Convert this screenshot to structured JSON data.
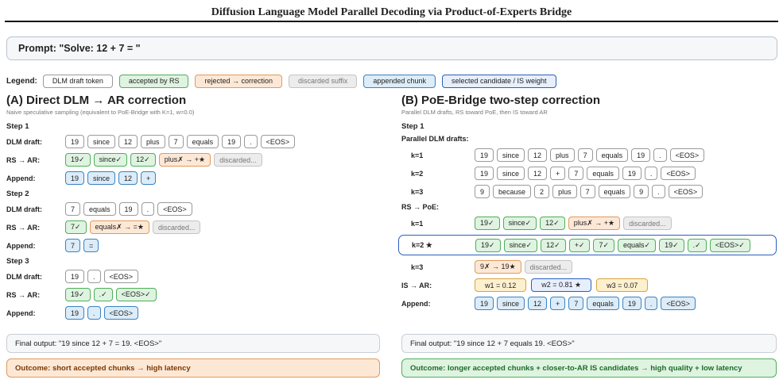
{
  "title": "Diffusion Language Model Parallel Decoding via Product-of-Experts Bridge",
  "prompt": "Prompt: \"Solve: 12 + 7 = \"",
  "legend": {
    "label": "Legend:",
    "items": [
      {
        "label": "DLM draft token",
        "kind": "draft"
      },
      {
        "label": "accepted by RS",
        "kind": "acc"
      },
      {
        "label": "rejected → correction",
        "kind": "rej"
      },
      {
        "label": "discarded suffix",
        "kind": "disc"
      },
      {
        "label": "appended chunk",
        "kind": "app"
      },
      {
        "label": "selected candidate / IS weight",
        "kind": "sel"
      }
    ]
  },
  "panel_a": {
    "title": "(A) Direct DLM → AR correction",
    "subtitle": "Naive speculative sampling (equivalent to PoE-Bridge with K=1, w=0.0)",
    "steps": [
      {
        "label": "Step 1",
        "draft_label": "DLM draft:",
        "draft": [
          "19",
          "since",
          "12",
          "plus",
          "7",
          "equals",
          "19",
          ".",
          "<EOS>"
        ],
        "rs_label": "RS → AR:",
        "rs": [
          {
            "t": "19✓",
            "k": "acc"
          },
          {
            "t": "since✓",
            "k": "acc"
          },
          {
            "t": "12✓",
            "k": "acc"
          },
          {
            "t": "plus✗ → +★",
            "k": "rej"
          },
          {
            "t": "discarded...",
            "k": "disc"
          }
        ],
        "append_label": "Append:",
        "append": [
          "19",
          "since",
          "12",
          "+"
        ]
      },
      {
        "label": "Step 2",
        "draft_label": "DLM draft:",
        "draft": [
          "7",
          "equals",
          "19",
          ".",
          "<EOS>"
        ],
        "rs_label": "RS → AR:",
        "rs": [
          {
            "t": "7✓",
            "k": "acc"
          },
          {
            "t": "equals✗ → =★",
            "k": "rej"
          },
          {
            "t": "discarded...",
            "k": "disc"
          }
        ],
        "append_label": "Append:",
        "append": [
          "7",
          "="
        ]
      },
      {
        "label": "Step 3",
        "draft_label": "DLM draft:",
        "draft": [
          "19",
          ".",
          "<EOS>"
        ],
        "rs_label": "RS → AR:",
        "rs": [
          {
            "t": "19✓",
            "k": "acc"
          },
          {
            "t": ".✓",
            "k": "acc"
          },
          {
            "t": "<EOS>✓",
            "k": "acc"
          }
        ],
        "append_label": "Append:",
        "append": [
          "19",
          ".",
          "<EOS>"
        ]
      }
    ],
    "final_output": "Final output: \"19 since 12 + 7 = 19. <EOS>\"",
    "outcome": "Outcome: short accepted chunks → high latency"
  },
  "panel_b": {
    "title": "(B) PoE-Bridge two-step correction",
    "subtitle": "Parallel DLM drafts, RS toward PoE, then IS toward AR",
    "step_label": "Step 1",
    "drafts_label": "Parallel DLM drafts:",
    "drafts": [
      {
        "k": "k=1",
        "tokens": [
          "19",
          "since",
          "12",
          "plus",
          "7",
          "equals",
          "19",
          ".",
          "<EOS>"
        ]
      },
      {
        "k": "k=2",
        "tokens": [
          "19",
          "since",
          "12",
          "+",
          "7",
          "equals",
          "19",
          ".",
          "<EOS>"
        ]
      },
      {
        "k": "k=3",
        "tokens": [
          "9",
          "because",
          "2",
          "plus",
          "7",
          "equals",
          "9",
          ".",
          "<EOS>"
        ]
      }
    ],
    "rs_label": "RS → PoE:",
    "rs": [
      {
        "k": "k=1",
        "selected": false,
        "tokens": [
          {
            "t": "19✓",
            "k": "acc"
          },
          {
            "t": "since✓",
            "k": "acc"
          },
          {
            "t": "12✓",
            "k": "acc"
          },
          {
            "t": "plus✗ → +★",
            "k": "rej"
          },
          {
            "t": "discarded...",
            "k": "disc"
          }
        ]
      },
      {
        "k": "k=2 ★",
        "selected": true,
        "tokens": [
          {
            "t": "19✓",
            "k": "acc"
          },
          {
            "t": "since✓",
            "k": "acc"
          },
          {
            "t": "12✓",
            "k": "acc"
          },
          {
            "t": "+✓",
            "k": "acc"
          },
          {
            "t": "7✓",
            "k": "acc"
          },
          {
            "t": "equals✓",
            "k": "acc"
          },
          {
            "t": "19✓",
            "k": "acc"
          },
          {
            "t": ".✓",
            "k": "acc"
          },
          {
            "t": "<EOS>✓",
            "k": "acc"
          }
        ]
      },
      {
        "k": "k=3",
        "selected": false,
        "tokens": [
          {
            "t": "9✗ → 19★",
            "k": "rej"
          },
          {
            "t": "discarded...",
            "k": "disc"
          }
        ]
      }
    ],
    "is_label": "IS → AR:",
    "is_weights": [
      {
        "t": "w1 = 0.12",
        "k": "w"
      },
      {
        "t": "w2 = 0.81 ★",
        "k": "wsel"
      },
      {
        "t": "w3 = 0.07",
        "k": "w"
      }
    ],
    "append_label": "Append:",
    "append": [
      "19",
      "since",
      "12",
      "+",
      "7",
      "equals",
      "19",
      ".",
      "<EOS>"
    ],
    "final_output": "Final output: \"19 since 12 + 7 equals 19. <EOS>\"",
    "outcome": "Outcome: longer accepted chunks + closer-to-AR IS candidates → high quality + low latency"
  }
}
